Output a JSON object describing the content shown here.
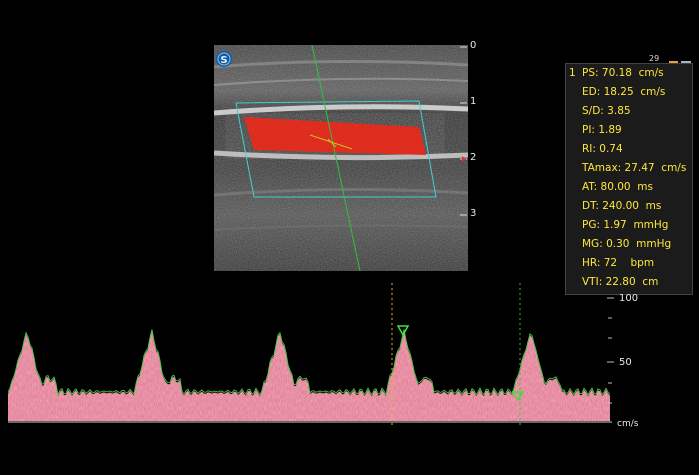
{
  "depth_scale": {
    "labels": [
      "0",
      "1",
      "2",
      "3"
    ]
  },
  "frame_counter": "29",
  "measurements": {
    "index": "1",
    "rows": [
      {
        "label": "PS:",
        "value": "70.18",
        "unit": "cm/s"
      },
      {
        "label": "ED:",
        "value": "18.25",
        "unit": "cm/s"
      },
      {
        "label": "S/D:",
        "value": "3.85",
        "unit": ""
      },
      {
        "label": "PI:",
        "value": "1.89",
        "unit": ""
      },
      {
        "label": "RI:",
        "value": "0.74",
        "unit": ""
      },
      {
        "label": "TAmax:",
        "value": "27.47",
        "unit": "cm/s"
      },
      {
        "label": "AT:",
        "value": "80.00",
        "unit": "ms"
      },
      {
        "label": "DT:",
        "value": "240.00",
        "unit": "ms"
      },
      {
        "label": "PG:",
        "value": "1.97",
        "unit": "mmHg"
      },
      {
        "label": "MG:",
        "value": "0.30",
        "unit": "mmHg"
      },
      {
        "label": "HR:",
        "value": "72",
        "unit": "bpm"
      },
      {
        "label": "VTI:",
        "value": "22.80",
        "unit": "cm"
      }
    ]
  },
  "velocity_scale": {
    "labels": [
      "100",
      "50",
      "cm/s"
    ]
  },
  "colors": {
    "measurement_text": "#ffe83a",
    "doppler_trace": "#e0708a",
    "envelope": "#44cc44",
    "color_flow": "#e02010",
    "roi_box": "#40d0d0",
    "cursor_line": "#30c040"
  },
  "icons": {
    "logo": "s-logo-icon"
  }
}
